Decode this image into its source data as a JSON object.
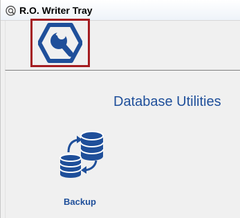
{
  "window": {
    "title": "R.O. Writer Tray",
    "app_icon": "ro-writer-app-icon"
  },
  "header": {
    "logo_icon": "hex-wrench-logo-icon"
  },
  "main": {
    "section_title": "Database Utilities",
    "utilities": [
      {
        "label": "Backup",
        "icon": "database-backup-icon"
      }
    ]
  },
  "colors": {
    "brand_blue": "#1f4f9a",
    "logo_frame": "#a41c20",
    "background": "#f0f0f0"
  }
}
